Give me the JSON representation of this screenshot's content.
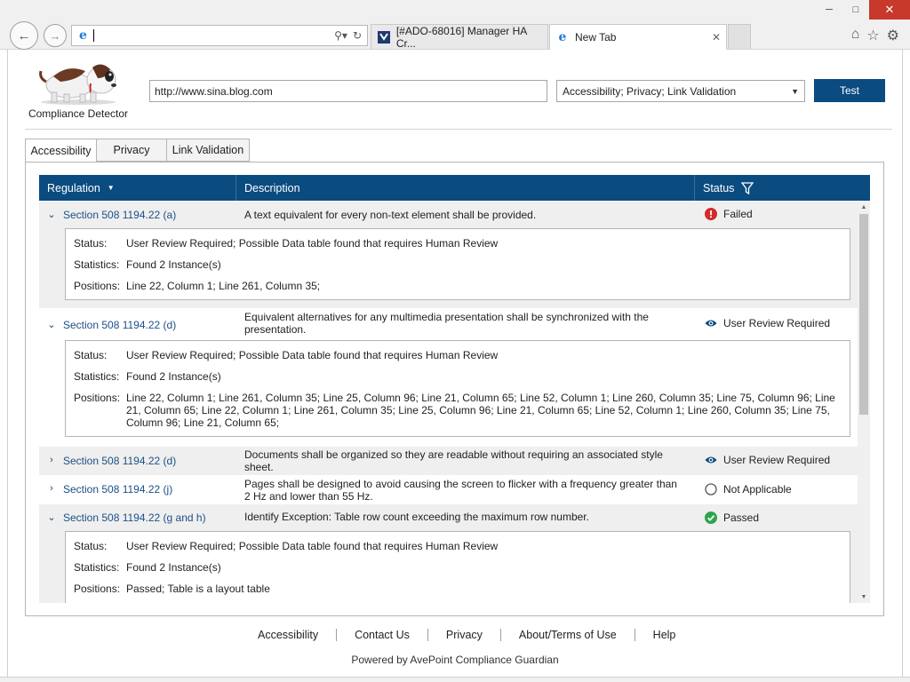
{
  "browser": {
    "address_value": "",
    "tabs": [
      {
        "label": "[#ADO-68016] Manager HA Cr...",
        "active": false
      },
      {
        "label": "New Tab",
        "active": true
      }
    ]
  },
  "app": {
    "name": "Compliance Detector",
    "url_value": "http://www.sina.blog.com",
    "profile_selected": "Accessibility; Privacy; Link Validation",
    "test_label": "Test"
  },
  "page_tabs": [
    {
      "label": "Accessibility",
      "active": true
    },
    {
      "label": "Privacy",
      "active": false
    },
    {
      "label": "Link Validation",
      "active": false
    }
  ],
  "table": {
    "headers": {
      "regulation": "Regulation",
      "description": "Description",
      "status": "Status"
    },
    "detail_labels": {
      "status": "Status:",
      "statistics": "Statistics:",
      "positions": "Positions:"
    },
    "rows": [
      {
        "regulation": "Section 508 1194.22 (a)",
        "description": "A text equivalent for every non-text element shall be provided.",
        "status": "Failed",
        "status_kind": "failed",
        "expanded": true,
        "detail": {
          "status": "User Review Required; Possible Data table found that requires Human Review",
          "statistics": "Found 2 Instance(s)",
          "positions": "Line 22, Column 1; Line 261, Column 35;"
        }
      },
      {
        "regulation": "Section 508 1194.22 (d)",
        "description": "Equivalent alternatives for any multimedia presentation shall be synchronized with the presentation.",
        "status": "User Review Required",
        "status_kind": "review",
        "expanded": true,
        "detail": {
          "status": "User Review Required; Possible Data table found that requires Human Review",
          "statistics": "Found 2 Instance(s)",
          "positions": "Line 22, Column 1; Line 261, Column 35; Line 25, Column 96; Line 21, Column 65; Line 52, Column 1; Line 260, Column 35; Line 75, Column 96; Line 21, Column 65; Line 22, Column 1; Line 261, Column 35; Line 25, Column 96; Line 21, Column 65; Line 52, Column 1; Line 260, Column 35; Line 75, Column 96; Line 21, Column 65;"
        }
      },
      {
        "regulation": "Section 508 1194.22 (d)",
        "description": "Documents shall be organized so they are readable without requiring an associated style sheet.",
        "status": "User Review Required",
        "status_kind": "review",
        "expanded": false
      },
      {
        "regulation": "Section 508 1194.22 (j)",
        "description": "Pages shall be designed to avoid causing the screen to flicker with a frequency greater than 2 Hz and lower than 55 Hz.",
        "status": "Not Applicable",
        "status_kind": "na",
        "expanded": false
      },
      {
        "regulation": "Section 508 1194.22 (g and h)",
        "description": "Identify Exception: Table row count exceeding the maximum row number.",
        "status": "Passed",
        "status_kind": "passed",
        "expanded": true,
        "detail": {
          "status": "User Review Required; Possible Data table found that requires Human Review",
          "statistics": "Found 2 Instance(s)",
          "positions": "Passed; Table is a layout table"
        }
      }
    ]
  },
  "footer": {
    "links": [
      "Accessibility",
      "Contact Us",
      "Privacy",
      "About/Terms of Use",
      "Help"
    ],
    "powered_by": "Powered by AvePoint Compliance Guardian"
  },
  "colors": {
    "brand": "#0a4b80",
    "failed": "#d42a2a",
    "passed": "#2ea44f",
    "link": "#1c4f86"
  }
}
